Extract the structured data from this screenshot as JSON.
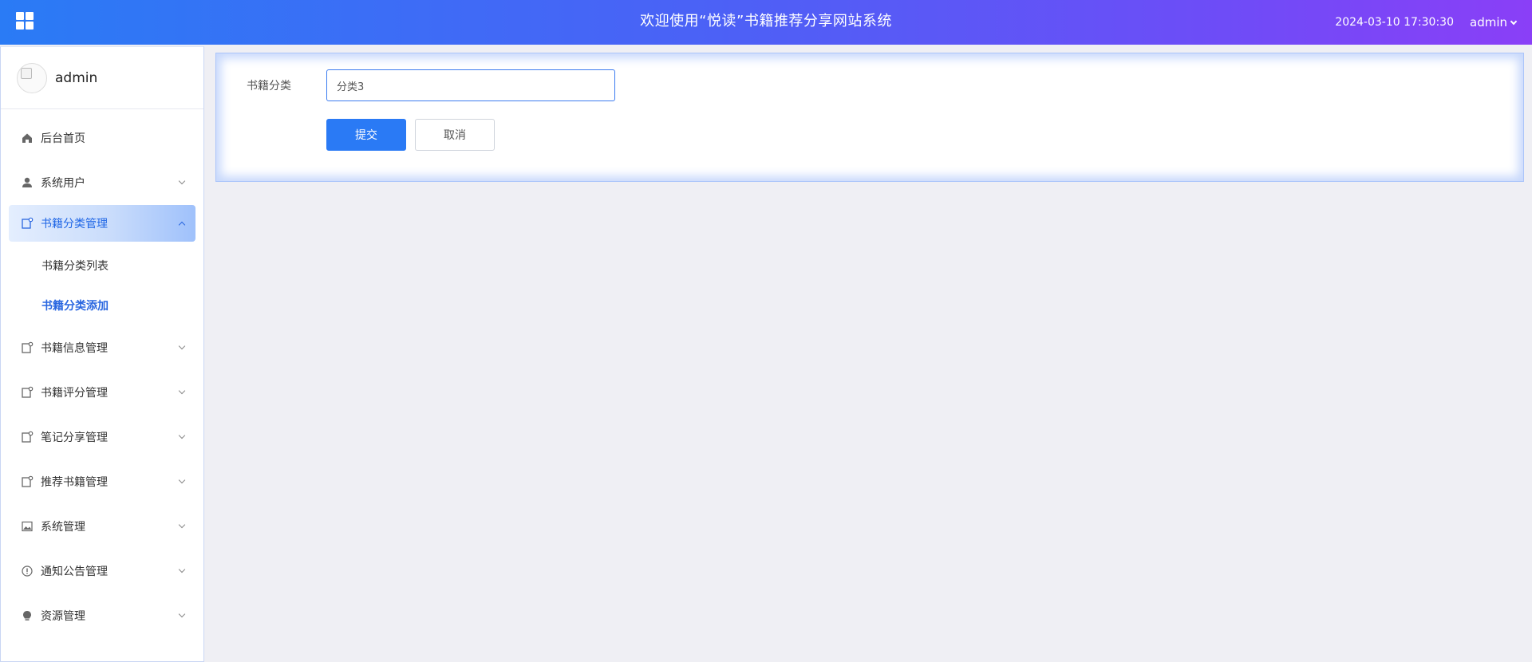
{
  "header": {
    "title": "欢迎使用“悦读”书籍推荐分享网站系统",
    "datetime": "2024-03-10 17:30:30",
    "user": "admin"
  },
  "sidebar": {
    "profile_name": "admin",
    "items": [
      {
        "label": "后台首页",
        "icon": "home-icon",
        "has_children": false
      },
      {
        "label": "系统用户",
        "icon": "user-icon",
        "has_children": true
      },
      {
        "label": "书籍分类管理",
        "icon": "module-icon",
        "has_children": true,
        "expanded": true,
        "children": [
          {
            "label": "书籍分类列表"
          },
          {
            "label": "书籍分类添加",
            "current": true
          }
        ]
      },
      {
        "label": "书籍信息管理",
        "icon": "module-icon",
        "has_children": true
      },
      {
        "label": "书籍评分管理",
        "icon": "module-icon",
        "has_children": true
      },
      {
        "label": "笔记分享管理",
        "icon": "module-icon",
        "has_children": true
      },
      {
        "label": "推荐书籍管理",
        "icon": "module-icon",
        "has_children": true
      },
      {
        "label": "系统管理",
        "icon": "picture-icon",
        "has_children": true
      },
      {
        "label": "通知公告管理",
        "icon": "info-circle-icon",
        "has_children": true
      },
      {
        "label": "资源管理",
        "icon": "bulb-icon",
        "has_children": true
      }
    ]
  },
  "form": {
    "category_label": "书籍分类",
    "category_value": "分类3",
    "submit_label": "提交",
    "cancel_label": "取消"
  },
  "colors": {
    "header_gradient_start": "#2a7bf5",
    "header_gradient_end": "#8a3ff7",
    "primary": "#2a7af5",
    "active_text": "#2a67e0",
    "background": "#efeff4"
  }
}
